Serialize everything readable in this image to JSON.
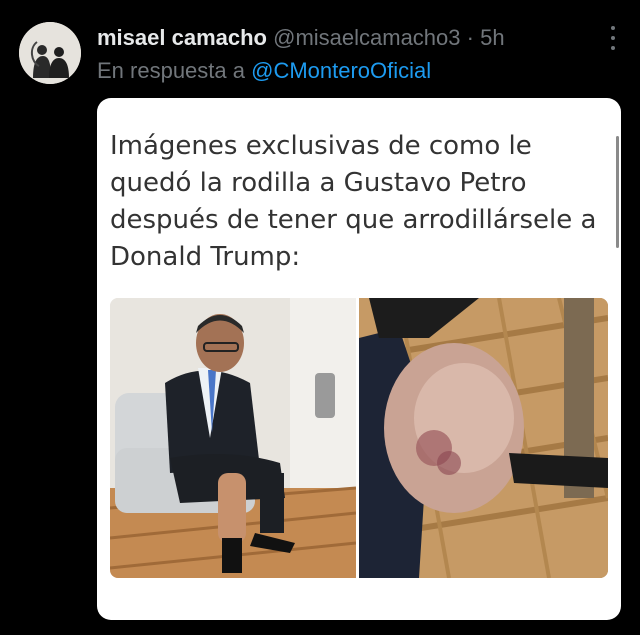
{
  "tweet": {
    "author_name": "misael camacho",
    "handle": "@misaelcamacho3",
    "separator": "·",
    "time": "5h",
    "reply_prefix": "En respuesta a",
    "reply_to": "@CMonteroOficial",
    "more_icon": "more-vertical-icon"
  },
  "media": {
    "caption": "Imágenes exclusivas de como le quedó la rodilla a Gustavo Petro después de tener que arrodillársele a Donald Trump:",
    "photos": [
      "photo-man-in-chair",
      "photo-knee-closeup"
    ]
  },
  "colors": {
    "background": "#000000",
    "primary_text": "#e7e9ea",
    "secondary_text": "#71767b",
    "link": "#1d9bf0",
    "card": "#ffffff"
  }
}
